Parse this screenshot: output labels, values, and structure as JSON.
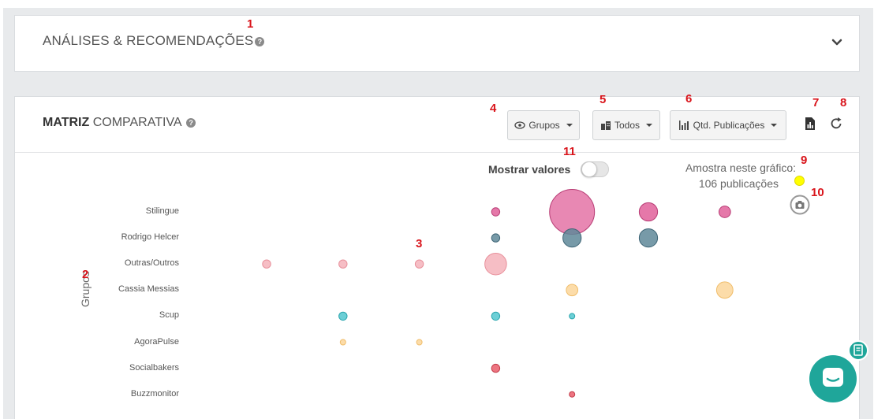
{
  "analises": {
    "title": "ANÁLISES & RECOMENDAÇÕES",
    "help": "?"
  },
  "matriz": {
    "title_bold": "MATRIZ",
    "title_rest": " COMPARATIVA",
    "help": "?",
    "buttons": {
      "groups": "Grupos",
      "all": "Todos",
      "metric": "Qtd. Publicações"
    },
    "toggle_label": "Mostrar valores",
    "sample_line1": "Amostra neste gráfico:",
    "sample_line2": "106 publicações"
  },
  "annotations": [
    "1",
    "2",
    "3",
    "4",
    "5",
    "6",
    "7",
    "8",
    "9",
    "10",
    "11"
  ],
  "colors": {
    "pink": "#e0609a",
    "slate": "#5f8899",
    "salmon": "#f5b3bb",
    "yellow": "#fbd69a",
    "teal": "#52c7cf",
    "red": "#ea5d6b",
    "accent_chat": "#1fa69a",
    "sample_dot": "#ffff00"
  },
  "icons": [
    "question-icon",
    "chevron-down-icon",
    "eye-icon",
    "building-icon",
    "bar-chart-icon",
    "pdf-chart-icon",
    "refresh-icon",
    "camera-icon",
    "chat-icon",
    "note-icon"
  ],
  "chart_data": {
    "type": "scatter",
    "ylabel": "Grupos",
    "categories": [
      "Stilingue",
      "Rodrigo Helcer",
      "Outras/Outros",
      "Cassia Messias",
      "Scup",
      "AgoraPulse",
      "Socialbakers",
      "Buzzmonitor"
    ],
    "column_count": 7,
    "points": [
      {
        "category": "Stilingue",
        "column": 3,
        "value": 1,
        "color": "pink"
      },
      {
        "category": "Stilingue",
        "column": 4,
        "value": 30,
        "color": "pink"
      },
      {
        "category": "Stilingue",
        "column": 5,
        "value": 5,
        "color": "pink"
      },
      {
        "category": "Stilingue",
        "column": 6,
        "value": 2,
        "color": "pink"
      },
      {
        "category": "Rodrigo Helcer",
        "column": 3,
        "value": 1,
        "color": "slate"
      },
      {
        "category": "Rodrigo Helcer",
        "column": 4,
        "value": 5,
        "color": "slate"
      },
      {
        "category": "Rodrigo Helcer",
        "column": 5,
        "value": 5,
        "color": "slate"
      },
      {
        "category": "Outras/Outros",
        "column": 0,
        "value": 1,
        "color": "salmon"
      },
      {
        "category": "Outras/Outros",
        "column": 1,
        "value": 1,
        "color": "salmon"
      },
      {
        "category": "Outras/Outros",
        "column": 2,
        "value": 1,
        "color": "salmon"
      },
      {
        "category": "Outras/Outros",
        "column": 3,
        "value": 7,
        "color": "salmon"
      },
      {
        "category": "Cassia Messias",
        "column": 4,
        "value": 2,
        "color": "yellow"
      },
      {
        "category": "Cassia Messias",
        "column": 6,
        "value": 4,
        "color": "yellow"
      },
      {
        "category": "Scup",
        "column": 1,
        "value": 1,
        "color": "teal"
      },
      {
        "category": "Scup",
        "column": 3,
        "value": 1,
        "color": "teal"
      },
      {
        "category": "Scup",
        "column": 4,
        "value": 0.4,
        "color": "teal"
      },
      {
        "category": "AgoraPulse",
        "column": 1,
        "value": 0.4,
        "color": "yellow"
      },
      {
        "category": "AgoraPulse",
        "column": 2,
        "value": 0.4,
        "color": "yellow"
      },
      {
        "category": "Socialbakers",
        "column": 3,
        "value": 1,
        "color": "red"
      },
      {
        "category": "Buzzmonitor",
        "column": 4,
        "value": 0.4,
        "color": "red"
      }
    ]
  }
}
